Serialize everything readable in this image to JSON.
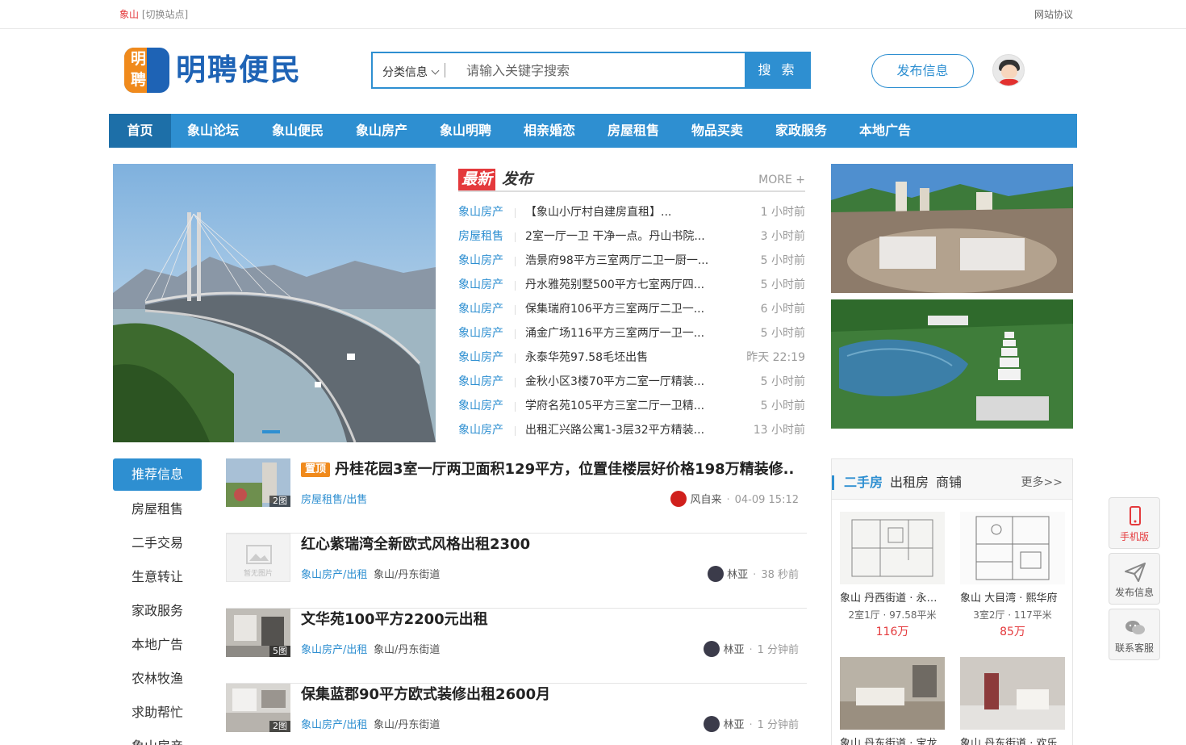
{
  "topbar": {
    "city": "象山",
    "switch": "[切换站点]",
    "protocol": "网站协议"
  },
  "logo": {
    "glyph1": "明",
    "glyph2": "聘",
    "text": "明聘便民"
  },
  "search": {
    "category": "分类信息",
    "placeholder": "请输入关键字搜索",
    "button": "搜 索"
  },
  "header": {
    "publish": "发布信息"
  },
  "nav": [
    "首页",
    "象山论坛",
    "象山便民",
    "象山房产",
    "象山明聘",
    "相亲婚恋",
    "房屋租售",
    "物品买卖",
    "家政服务",
    "本地广告"
  ],
  "latest": {
    "tag1": "最新",
    "tag2": "发布",
    "more": "MORE +",
    "items": [
      {
        "cat": "象山房产",
        "title": "【象山小厅村自建房直租】...",
        "time": "1 小时前"
      },
      {
        "cat": "房屋租售",
        "title": "2室一厅一卫 干净一点。丹山书院...",
        "time": "3 小时前"
      },
      {
        "cat": "象山房产",
        "title": "浩景府98平方三室两厅二卫一厨一...",
        "time": "5 小时前"
      },
      {
        "cat": "象山房产",
        "title": "丹水雅苑别墅500平方七室两厅四...",
        "time": "5 小时前"
      },
      {
        "cat": "象山房产",
        "title": "保集瑞府106平方三室两厅二卫一...",
        "time": "6 小时前"
      },
      {
        "cat": "象山房产",
        "title": "涌金广场116平方三室两厅一卫一...",
        "time": "5 小时前"
      },
      {
        "cat": "象山房产",
        "title": "永泰华苑97.58毛坯出售",
        "time": "昨天 22:19"
      },
      {
        "cat": "象山房产",
        "title": "金秋小区3楼70平方二室一厅精装...",
        "time": "5 小时前"
      },
      {
        "cat": "象山房产",
        "title": "学府名苑105平方三室二厅一卫精...",
        "time": "5 小时前"
      },
      {
        "cat": "象山房产",
        "title": "出租汇兴路公寓1-3层32平方精装...",
        "time": "13 小时前"
      }
    ]
  },
  "side": [
    "推荐信息",
    "房屋租售",
    "二手交易",
    "生意转让",
    "家政服务",
    "本地广告",
    "农林牧渔",
    "求助帮忙",
    "象山房产"
  ],
  "feed": [
    {
      "badge": "置顶",
      "title": "丹桂花园3室一厅两卫面积129平方，位置佳楼层好价格198万精装修...",
      "cat": "房屋租售/出售",
      "loc": "",
      "user": "风自来",
      "time": "04-09 15:12",
      "pics": "2图",
      "avatarColor": "#d0201c"
    },
    {
      "badge": "",
      "title": "红心紫瑞湾全新欧式风格出租2300",
      "cat": "象山房产/出租",
      "loc": "象山/丹东街道",
      "user": "林亚",
      "time": "38 秒前",
      "pics": "",
      "noimg": "暂无图片",
      "avatarColor": "#3b3b4a"
    },
    {
      "badge": "",
      "title": "文华苑100平方2200元出租",
      "cat": "象山房产/出租",
      "loc": "象山/丹东街道",
      "user": "林亚",
      "time": "1 分钟前",
      "pics": "5图",
      "avatarColor": "#3b3b4a"
    },
    {
      "badge": "",
      "title": "保集蓝郡90平方欧式装修出租2600月",
      "cat": "象山房产/出租",
      "loc": "象山/丹东街道",
      "user": "林亚",
      "time": "1 分钟前",
      "pics": "2图",
      "avatarColor": "#3b3b4a"
    }
  ],
  "housing": {
    "tab1": "二手房",
    "tab2": "出租房",
    "tab3": "商铺",
    "more": "更多>>",
    "cards": [
      {
        "name": "象山 丹西街道 · 永泰华苑",
        "spec": "2室1厅 · 97.58平米",
        "price": "116万"
      },
      {
        "name": "象山 大目湾 · 熙华府",
        "spec": "3室2厅 · 117平米",
        "price": "85万"
      },
      {
        "name": "象山 丹东街道 · 宝龙",
        "spec": "",
        "price": ""
      },
      {
        "name": "象山 丹东街道 · 欢乐",
        "spec": "",
        "price": ""
      }
    ]
  },
  "float": {
    "mobile": "手机版",
    "publish": "发布信息",
    "service": "联系客服"
  },
  "colors": {
    "accent": "#2e8fd1",
    "red": "#e4393c",
    "orange": "#f08a1c",
    "logoBlue": "#1e63b5"
  }
}
